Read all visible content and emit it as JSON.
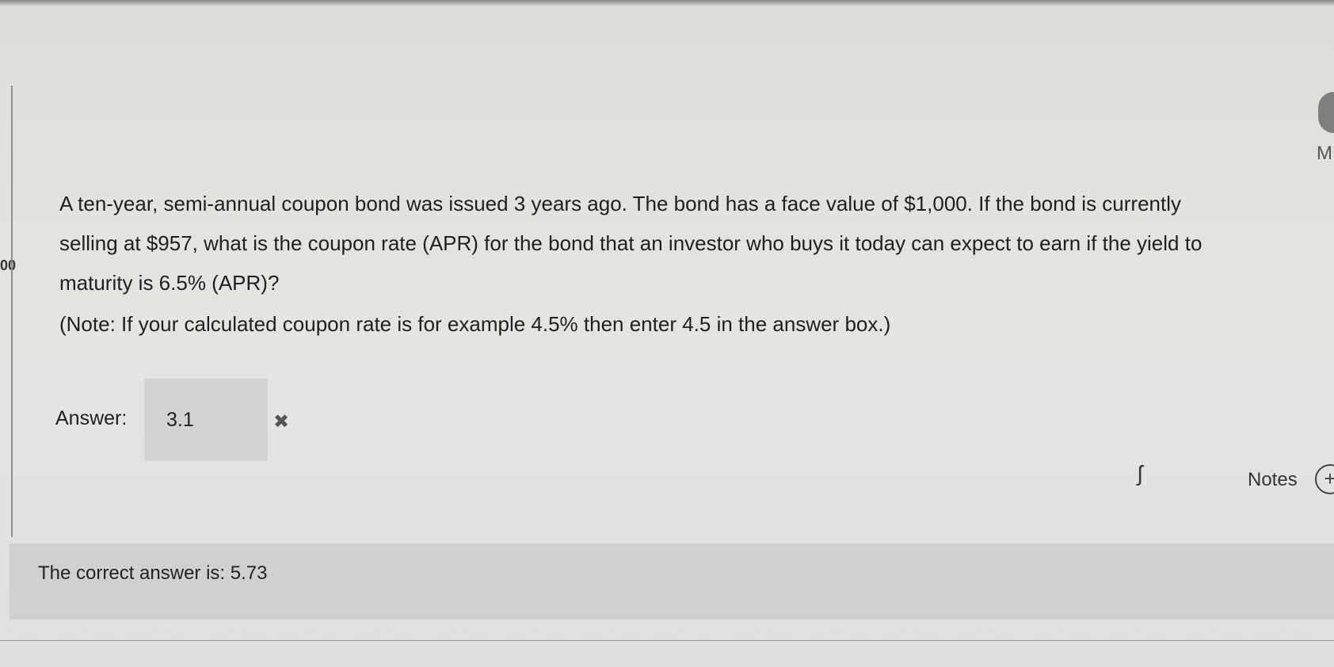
{
  "side": {
    "page_number_fragment": "00",
    "right_letter": "M"
  },
  "question": {
    "text": "A ten-year, semi-annual coupon bond was issued 3 years ago. The bond has a face value of $1,000. If the bond is currently selling at $957, what is the coupon rate (APR) for the bond that an investor who buys it today can expect to earn if the yield to maturity is 6.5% (APR)?",
    "note": "(Note: If your calculated coupon rate is for example 4.5% then enter 4.5 in the answer box.)"
  },
  "answer": {
    "label": "Answer:",
    "value": "3.1",
    "status_icon": "✖",
    "status": "incorrect"
  },
  "notes": {
    "label": "Notes",
    "button_symbol": "+"
  },
  "feedback": {
    "correct_answer_text": "The correct answer is: 5.73"
  }
}
